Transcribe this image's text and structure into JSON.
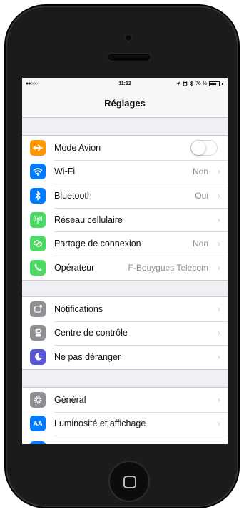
{
  "device": {
    "home_button_icon": "home-square-icon"
  },
  "status_bar": {
    "signal": "●●○○○",
    "time": "11:12",
    "icons": [
      "location-icon",
      "alarm-icon",
      "bluetooth-icon"
    ],
    "battery_text": "76 %",
    "battery_level_percent": 76
  },
  "navbar": {
    "title": "Réglages"
  },
  "group1": {
    "rows": [
      {
        "label": "Mode Avion",
        "icon": "airplane-icon",
        "color": "#ff9500",
        "toggle": false
      },
      {
        "label": "Wi-Fi",
        "icon": "wifi-icon",
        "color": "#007aff",
        "value": "Non"
      },
      {
        "label": "Bluetooth",
        "icon": "bluetooth-icon",
        "color": "#007aff",
        "value": "Oui"
      },
      {
        "label": "Réseau cellulaire",
        "icon": "antenna-icon",
        "color": "#4cd964",
        "value": ""
      },
      {
        "label": "Partage de connexion",
        "icon": "chain-link-icon",
        "color": "#4cd964",
        "value": "Non"
      },
      {
        "label": "Opérateur",
        "icon": "phone-icon",
        "color": "#4cd964",
        "value": "F-Bouygues Telecom"
      }
    ]
  },
  "group2": {
    "rows": [
      {
        "label": "Notifications",
        "icon": "notifications-icon",
        "color": "#8e8e93"
      },
      {
        "label": "Centre de contrôle",
        "icon": "control-center-icon",
        "color": "#8e8e93"
      },
      {
        "label": "Ne pas déranger",
        "icon": "moon-icon",
        "color": "#5856d6"
      }
    ]
  },
  "group3": {
    "rows": [
      {
        "label": "Général",
        "icon": "gear-icon",
        "color": "#8e8e93"
      },
      {
        "label": "Luminosité et affichage",
        "icon": "text-size-icon",
        "color": "#007aff",
        "icon_text": "AA"
      }
    ]
  },
  "chevron": "›"
}
